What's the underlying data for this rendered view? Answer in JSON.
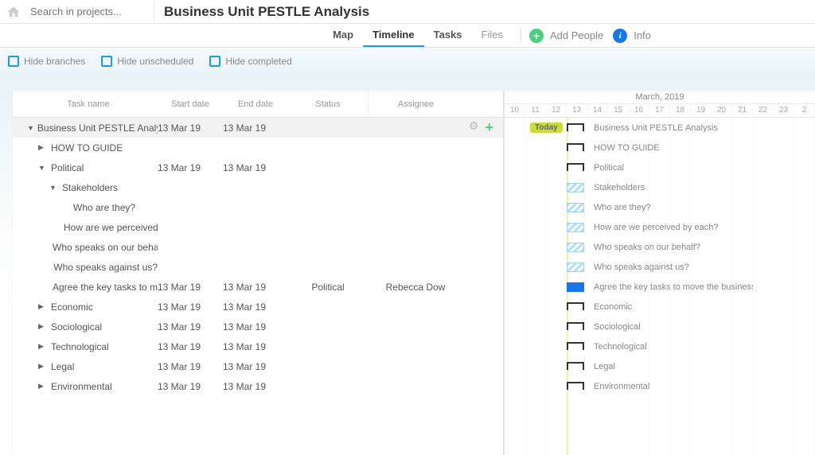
{
  "search_placeholder": "Search in projects...",
  "project_title": "Business Unit PESTLE Analysis",
  "tabs": {
    "map": "Map",
    "timeline": "Timeline",
    "tasks": "Tasks",
    "files": "Files",
    "add_people": "Add People",
    "info": "Info"
  },
  "filters": {
    "hide_branches": "Hide branches",
    "hide_unscheduled": "Hide unscheduled",
    "hide_completed": "Hide completed"
  },
  "columns": {
    "name": "Task name",
    "start": "Start date",
    "end": "End date",
    "status": "Status",
    "assignee": "Assignee"
  },
  "tasks": [
    {
      "name": "Business Unit PESTLE Analysis",
      "start": "13 Mar 19",
      "end": "13 Mar 19",
      "level": 0,
      "expanded": true,
      "top": true,
      "bar": "bracket"
    },
    {
      "name": "HOW TO GUIDE",
      "start": "",
      "end": "",
      "level": 1,
      "expanded": false,
      "bar": "bracket"
    },
    {
      "name": "Political",
      "start": "13 Mar 19",
      "end": "13 Mar 19",
      "level": 1,
      "expanded": true,
      "bar": "bracket"
    },
    {
      "name": "Stakeholders",
      "start": "",
      "end": "",
      "level": 2,
      "expanded": true,
      "bar": "striped"
    },
    {
      "name": "Who are they?",
      "start": "",
      "end": "",
      "level": 3,
      "bar": "striped"
    },
    {
      "name": "How are we perceived by each?",
      "start": "",
      "end": "",
      "level": 3,
      "truncate": "How are we perceived l",
      "bar": "striped"
    },
    {
      "name": "Who speaks on our behalf?",
      "start": "",
      "end": "",
      "level": 2,
      "truncate": "Who speaks on our behal",
      "bar": "striped"
    },
    {
      "name": "Who speaks against us?",
      "start": "",
      "end": "",
      "level": 2,
      "bar": "striped"
    },
    {
      "name": "Agree the key tasks to move the business for…",
      "start": "13 Mar 19",
      "end": "13 Mar 19",
      "level": 2,
      "status": "Political",
      "assignee": "Rebecca Dow",
      "truncate": "Agree the key tasks to mo",
      "bar": "solid"
    },
    {
      "name": "Economic",
      "start": "13 Mar 19",
      "end": "13 Mar 19",
      "level": 1,
      "expanded": false,
      "bar": "bracket"
    },
    {
      "name": "Sociological",
      "start": "13 Mar 19",
      "end": "13 Mar 19",
      "level": 1,
      "expanded": false,
      "bar": "bracket"
    },
    {
      "name": "Technological",
      "start": "13 Mar 19",
      "end": "13 Mar 19",
      "level": 1,
      "expanded": false,
      "bar": "bracket"
    },
    {
      "name": "Legal",
      "start": "13 Mar 19",
      "end": "13 Mar 19",
      "level": 1,
      "expanded": false,
      "bar": "bracket"
    },
    {
      "name": "Environmental",
      "start": "13 Mar 19",
      "end": "13 Mar 19",
      "level": 1,
      "expanded": false,
      "bar": "bracket"
    }
  ],
  "gantt": {
    "month": "March, 2019",
    "days": [
      "10",
      "11",
      "12",
      "13",
      "14",
      "15",
      "16",
      "17",
      "18",
      "19",
      "20",
      "21",
      "22",
      "23",
      "2"
    ],
    "today": "Today"
  }
}
